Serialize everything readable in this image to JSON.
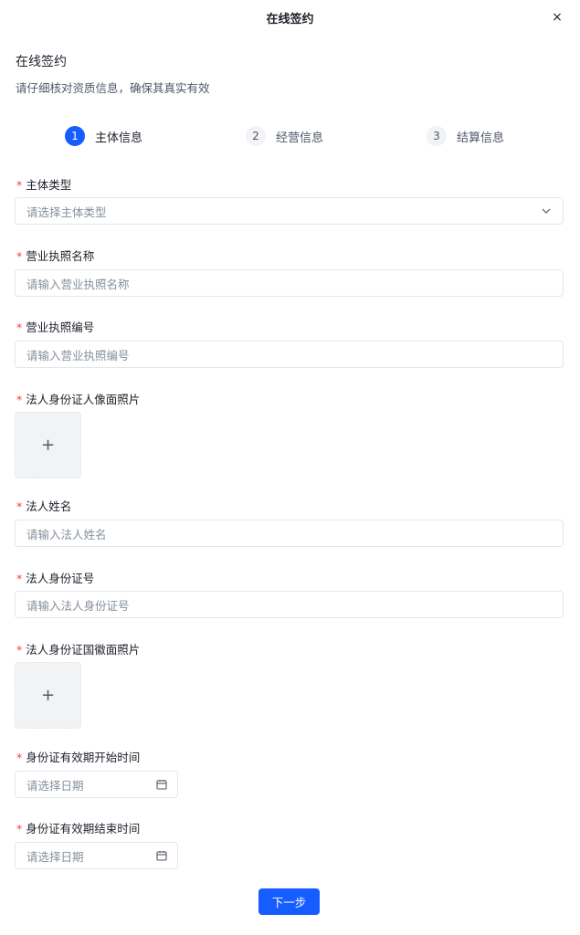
{
  "modal": {
    "title": "在线签约",
    "close_label": "×"
  },
  "section": {
    "title": "在线签约",
    "subtitle": "请仔细核对资质信息，确保其真实有效"
  },
  "steps": [
    {
      "num": "1",
      "label": "主体信息",
      "active": true
    },
    {
      "num": "2",
      "label": "经营信息",
      "active": false
    },
    {
      "num": "3",
      "label": "结算信息",
      "active": false
    }
  ],
  "required_mark": "*",
  "fields": {
    "entity_type": {
      "label": "主体类型",
      "placeholder": "请选择主体类型"
    },
    "license_name": {
      "label": "营业执照名称",
      "placeholder": "请输入营业执照名称"
    },
    "license_number": {
      "label": "营业执照编号",
      "placeholder": "请输入营业执照编号"
    },
    "id_front_photo": {
      "label": "法人身份证人像面照片",
      "upload_icon": "+"
    },
    "legal_name": {
      "label": "法人姓名",
      "placeholder": "请输入法人姓名"
    },
    "legal_id_number": {
      "label": "法人身份证号",
      "placeholder": "请输入法人身份证号"
    },
    "id_back_photo": {
      "label": "法人身份证国徽面照片",
      "upload_icon": "+"
    },
    "id_valid_start": {
      "label": "身份证有效期开始时间",
      "placeholder": "请选择日期"
    },
    "id_valid_end": {
      "label": "身份证有效期结束时间",
      "placeholder": "请选择日期"
    }
  },
  "actions": {
    "next_label": "下一步"
  },
  "colors": {
    "primary": "#165dff",
    "required": "#f53f3f"
  }
}
